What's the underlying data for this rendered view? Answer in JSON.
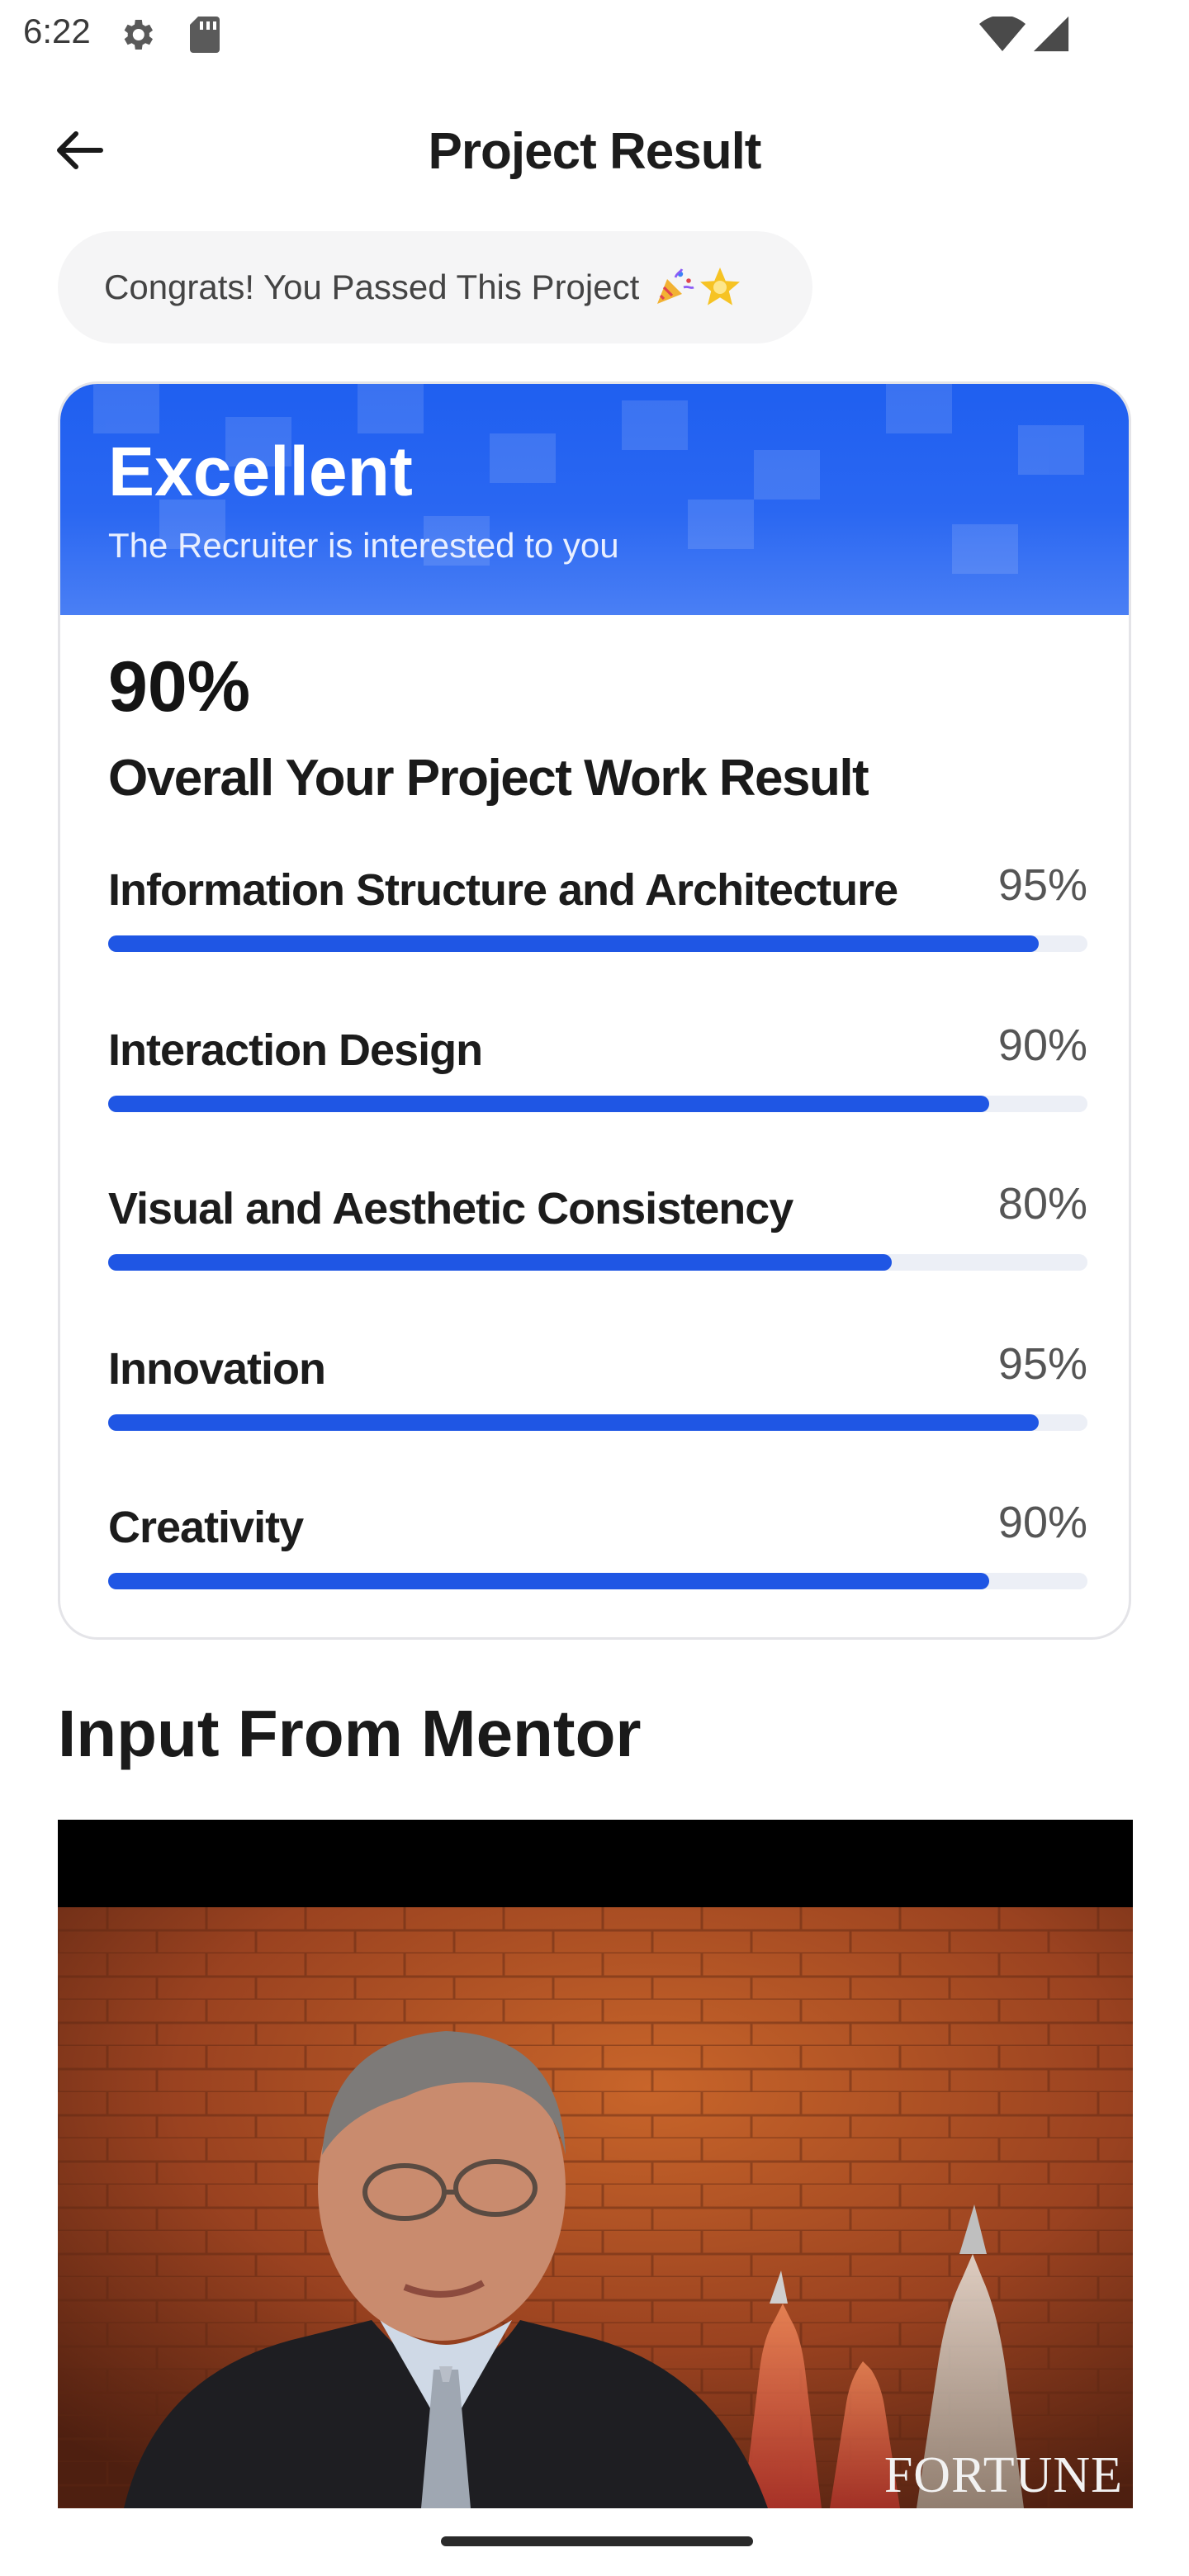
{
  "status_bar": {
    "time": "6:22",
    "icons": [
      "gear-icon",
      "sd-card-icon",
      "wifi-icon",
      "signal-icon"
    ]
  },
  "header": {
    "title": "Project Result",
    "back_icon": "arrow-left-icon"
  },
  "congrats": {
    "text": "Congrats! You Passed This Project",
    "emojis": [
      "party-popper-icon",
      "star-icon"
    ]
  },
  "result_card": {
    "banner_title": "Excellent",
    "banner_subtitle": "The Recruiter is interested to you",
    "overall_percent": "90%",
    "overall_label": "Overall Your Project Work Result",
    "accent_color": "#1f56e4",
    "scores": [
      {
        "name": "Information Structure and Architecture",
        "value": "95%",
        "fraction": 0.95
      },
      {
        "name": "Interaction Design",
        "value": "90%",
        "fraction": 0.9
      },
      {
        "name": "Visual and Aesthetic Consistency",
        "value": "80%",
        "fraction": 0.8
      },
      {
        "name": "Innovation",
        "value": "95%",
        "fraction": 0.95
      },
      {
        "name": "Creativity",
        "value": "90%",
        "fraction": 0.9
      }
    ]
  },
  "mentor": {
    "heading": "Input From Mentor",
    "video_watermark": "FORTUNE"
  }
}
